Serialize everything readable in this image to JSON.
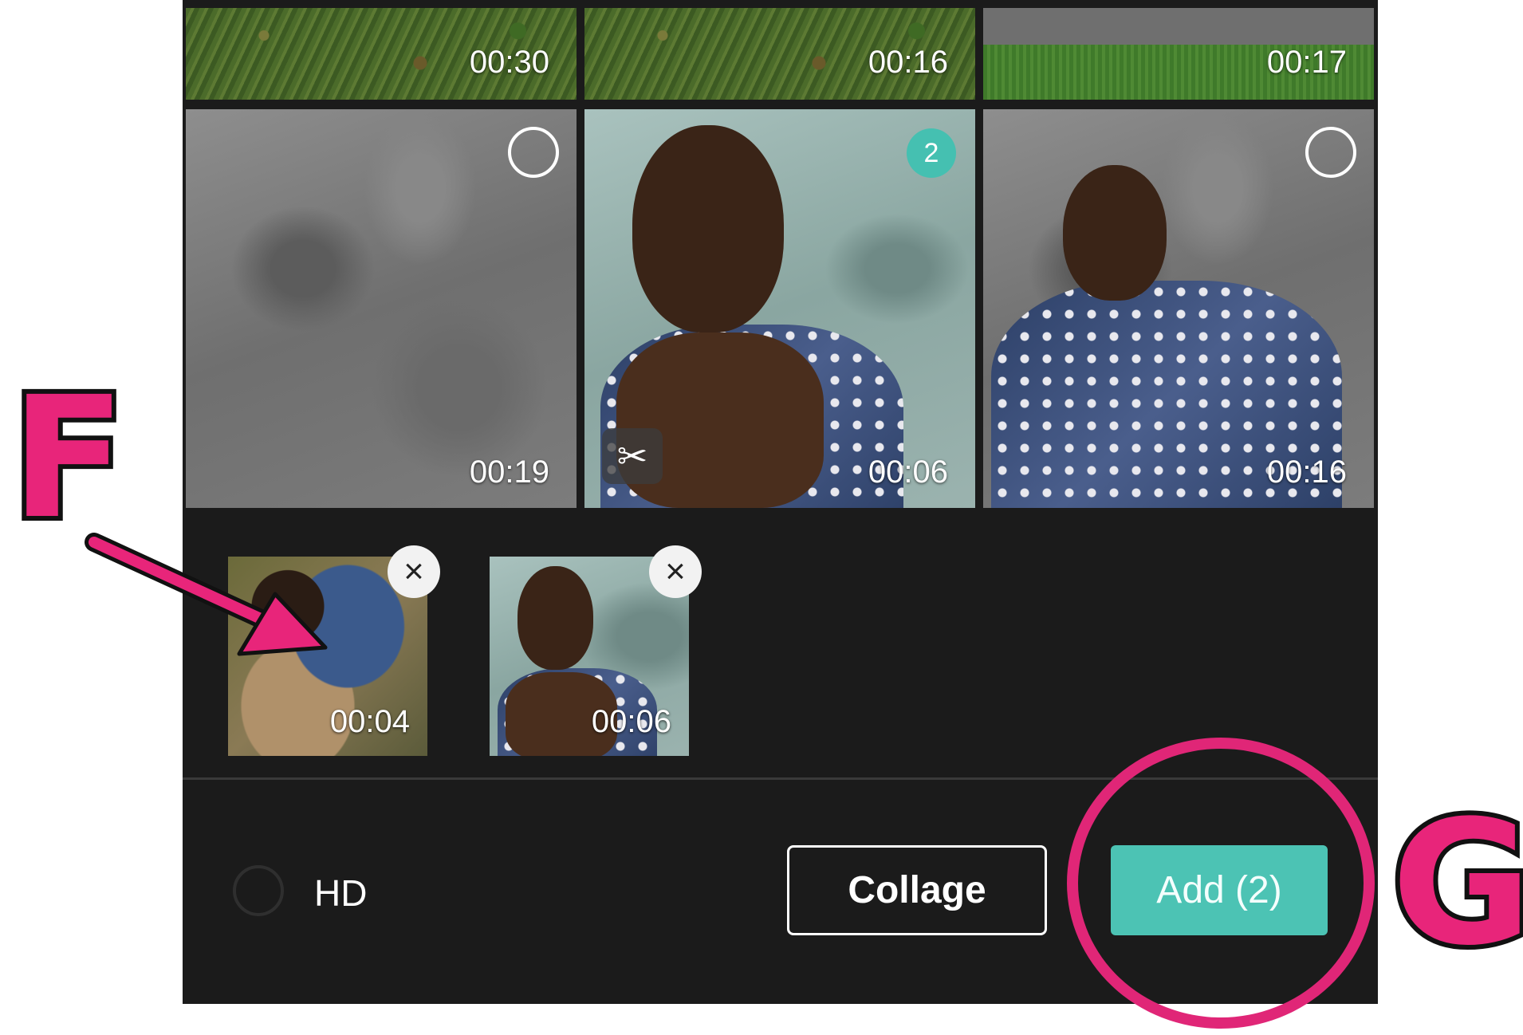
{
  "grid": {
    "top_row": [
      {
        "duration": "00:30"
      },
      {
        "duration": "00:16"
      },
      {
        "duration": "00:17"
      }
    ],
    "middle_row": [
      {
        "duration": "00:19",
        "selected": false
      },
      {
        "duration": "00:06",
        "selected": true,
        "selection_number": "2"
      },
      {
        "duration": "00:16",
        "selected": false
      }
    ]
  },
  "selected_tray": [
    {
      "duration": "00:04",
      "remove_icon": "close-icon"
    },
    {
      "duration": "00:06",
      "remove_icon": "close-icon"
    }
  ],
  "icons": {
    "trim": "scissors-icon",
    "remove": "close-icon"
  },
  "remove_glyph": "×",
  "scissors_glyph": "✂",
  "bottom_bar": {
    "hd_label": "HD",
    "hd_checked": false,
    "collage_label": "Collage",
    "add_label": "Add (2)"
  },
  "annotations": {
    "label_f": "F",
    "label_g": "G"
  },
  "colors": {
    "accent": "#4cc3b4",
    "annotation": "#e8257a",
    "background": "#1b1b1b"
  }
}
